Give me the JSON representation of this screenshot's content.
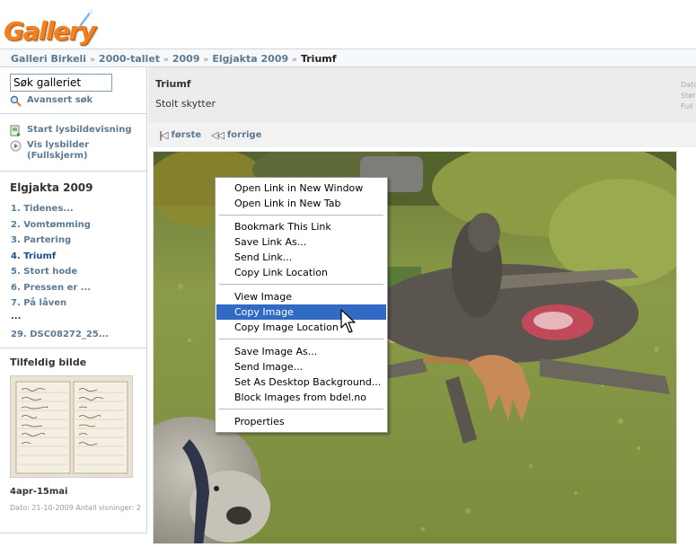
{
  "logo": {
    "text": "Gallery"
  },
  "breadcrumb": {
    "items": [
      "Galleri Birkeli",
      "2000-tallet",
      "2009",
      "Elgjakta 2009"
    ],
    "current": "Triumf",
    "separator": "»"
  },
  "sidebar": {
    "search_value": "Søk galleriet",
    "advanced_search": "Avansert søk",
    "slideshow": "Start lysbildevisning",
    "fullscreen_line1": "Vis lysbilder",
    "fullscreen_line2": "(Fullskjerm)",
    "album_title": "Elgjakta 2009",
    "album_items": [
      "1. Tidenes...",
      "2. Vomtømming",
      "3. Partering",
      "4. Triumf",
      "5. Stort hode",
      "6. Pressen er ...",
      "7. På låven",
      "...",
      "29. DSC08272_25..."
    ],
    "random_title": "Tilfeldig bilde",
    "random_caption": "4apr-15mai",
    "random_meta": "Dato: 21-10-2009 Antall visninger: 2"
  },
  "info": {
    "title": "Triumf",
    "description": "Stolt skytter",
    "meta_lines": [
      "Dato",
      "Stør",
      "Full"
    ]
  },
  "nav": {
    "first": "første",
    "previous": "forrige"
  },
  "context_menu": {
    "items": [
      "Open Link in New Window",
      "Open Link in New Tab",
      "Bookmark This Link",
      "Save Link As...",
      "Send Link...",
      "Copy Link Location",
      "View Image",
      "Copy Image",
      "Copy Image Location",
      "Save Image As...",
      "Send Image...",
      "Set As Desktop Background...",
      "Block Images from bdel.no",
      "Properties"
    ],
    "highlighted": "Copy Image"
  },
  "colors": {
    "link": "#5b7a95",
    "logo_orange": "#f5801e",
    "menu_highlight": "#316ac5",
    "info_bg": "#ececec"
  }
}
